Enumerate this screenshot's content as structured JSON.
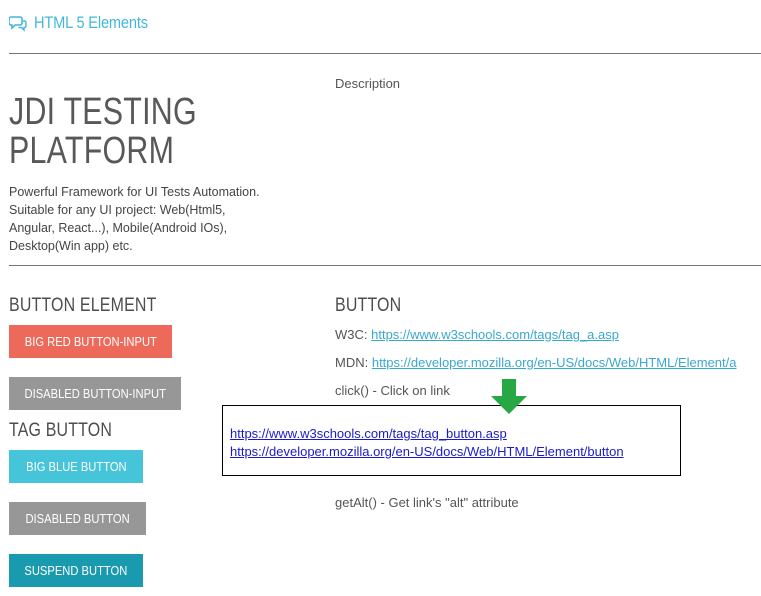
{
  "header": {
    "icon": "comments-icon",
    "title": "HTML 5 Elements"
  },
  "description_label": "Description",
  "jdi": {
    "title_line1": "JDI TESTING",
    "title_line2": "PLATFORM",
    "subtitle_lines": [
      "Powerful Framework for UI Tests Automation.",
      "Suitable for any UI project: Web(Html5,",
      "Angular, React...), Mobile(Android IOs),",
      "Desktop(Win app) etc."
    ]
  },
  "left": {
    "button_element_title": "BUTTON ELEMENT",
    "big_red_button": "BIG RED BUTTON-INPUT",
    "disabled_button_input": "DISABLED BUTTON-INPUT",
    "tag_button_title": "TAG BUTTON",
    "big_blue_button": "BIG BLUE BUTTON",
    "disabled_button": "DISABLED BUTTON",
    "suspend_button": "SUSPEND BUTTON"
  },
  "right": {
    "button_title": "BUTTON",
    "w3c_label": "W3C: ",
    "w3c_link": "https://www.w3schools.com/tags/tag_a.asp",
    "mdn_label": "MDN: ",
    "mdn_link": "https://developer.mozilla.org/en-US/docs/Web/HTML/Element/a",
    "click_text": "click() - Click on link",
    "getalt_text": "getAlt() - Get link's \"alt\" attribute"
  },
  "callout": {
    "link1": "https://www.w3schools.com/tags/tag_button.asp",
    "link2": "https://developer.mozilla.org/en-US/docs/Web/HTML/Element/button",
    "arrow_icon": "down-arrow-icon",
    "arrow_color": "#27a844"
  },
  "colors": {
    "accent": "#42b7d6",
    "red_button": "#ed6a5a",
    "gray_button": "#979797",
    "blue_button": "#45c4da",
    "teal_button": "#1a9aae",
    "link": "#39a8cf"
  }
}
